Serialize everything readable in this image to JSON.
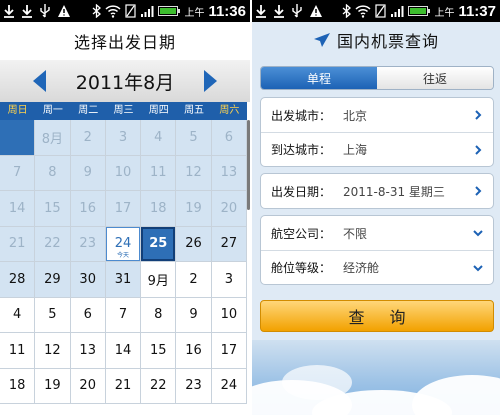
{
  "left_screen": {
    "status": {
      "ampm": "上午",
      "time": "11:36"
    },
    "title": "选择出发日期",
    "month": "2011年8月",
    "weekdays": [
      "周日",
      "周一",
      "周二",
      "周三",
      "周四",
      "周五",
      "周六"
    ],
    "calendar_rows": [
      [
        "",
        "8月",
        "2",
        "3",
        "4",
        "5",
        "6"
      ],
      [
        "7",
        "8",
        "9",
        "10",
        "11",
        "12",
        "13"
      ],
      [
        "14",
        "15",
        "16",
        "17",
        "18",
        "19",
        "20"
      ],
      [
        "21",
        "22",
        "23",
        "24",
        "25",
        "26",
        "27"
      ],
      [
        "28",
        "29",
        "30",
        "31",
        "9月",
        "2",
        "3"
      ],
      [
        "4",
        "5",
        "6",
        "7",
        "8",
        "9",
        "10"
      ],
      [
        "11",
        "12",
        "13",
        "14",
        "15",
        "16",
        "17"
      ],
      [
        "18",
        "19",
        "20",
        "21",
        "22",
        "23",
        "24"
      ]
    ],
    "today_label": "今天",
    "today_day": "24",
    "selected_day": "25",
    "colors": {
      "header_blue": "#1f5faa",
      "selected_blue": "#2e6fb6",
      "past_bg": "#d3e3f2",
      "weekend_text": "#ffd34d"
    }
  },
  "right_screen": {
    "status": {
      "ampm": "上午",
      "time": "11:37"
    },
    "title": "国内机票查询",
    "tabs": {
      "oneway": "单程",
      "roundtrip": "往返"
    },
    "fields": {
      "departure_city": {
        "label": "出发城市：",
        "value": "北京"
      },
      "arrival_city": {
        "label": "到达城市：",
        "value": "上海"
      },
      "departure_date": {
        "label": "出发日期：",
        "value": "2011-8-31 星期三"
      },
      "airline": {
        "label": "航空公司：",
        "value": "不限"
      },
      "cabin_class": {
        "label": "舱位等级：",
        "value": "经济舱"
      }
    },
    "query_button": "查 询",
    "colors": {
      "accent": "#f2a100",
      "tab_active": "#1d62b5"
    }
  }
}
